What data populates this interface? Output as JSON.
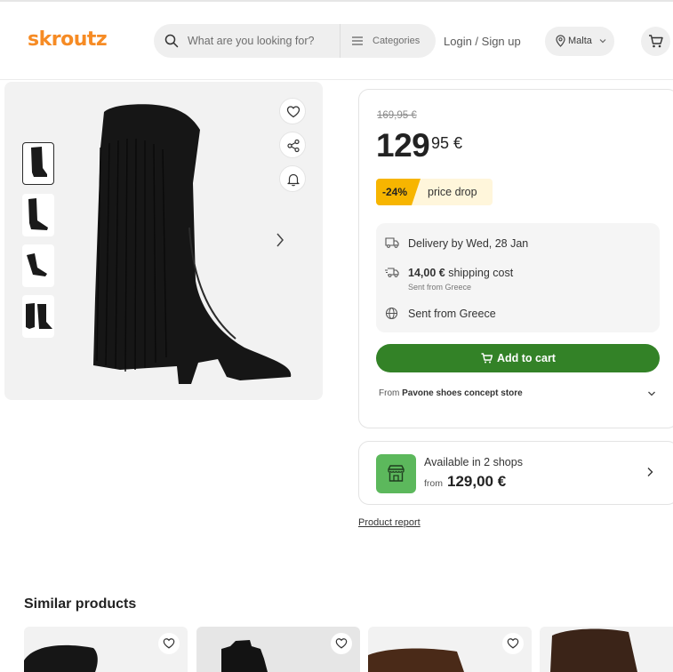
{
  "header": {
    "logo": "skroutz",
    "search_placeholder": "What are you looking for?",
    "categories_label": "Categories",
    "login_label": "Login / Sign up",
    "location_label": "Malta"
  },
  "gallery": {
    "thumbnails": [
      "thumb-1",
      "thumb-2",
      "thumb-3",
      "thumb-4"
    ],
    "selected_index": 0
  },
  "price": {
    "old_price": "169,95 €",
    "integer": "129",
    "decimals": "95 €",
    "discount": "-24%",
    "discount_label": "price drop"
  },
  "delivery": {
    "delivery_text": "Delivery by Wed, 28 Jan",
    "shipping_amount": "14,00 €",
    "shipping_label": "shipping cost",
    "shipping_sub": "Sent from Greece",
    "origin_text": "Sent from Greece"
  },
  "add_to_cart_label": "Add to cart",
  "seller": {
    "from_label": "From",
    "store_name": "Pavone shoes concept store"
  },
  "shops": {
    "available_text": "Available in 2 shops",
    "from_label": "from",
    "from_price": "129,00 €"
  },
  "product_report_label": "Product report",
  "similar": {
    "title": "Similar products"
  },
  "colors": {
    "brand": "#f68b24",
    "cart_green": "#338227",
    "discount_yellow": "#f7b500",
    "shop_icon_green": "#5cb85c"
  }
}
